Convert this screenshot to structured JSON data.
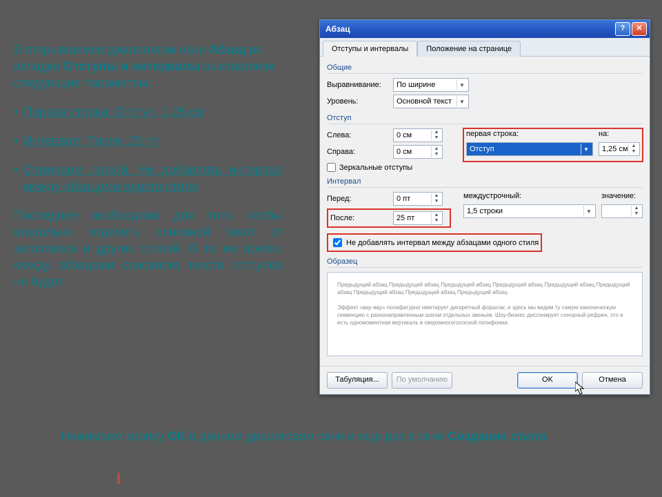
{
  "instruction": {
    "intro_pre": "В открывшемся диалоговом окне ",
    "intro_b1": "Абзац",
    "intro_mid": " во вкладке ",
    "intro_b2": "Отступы и интервалы",
    "intro_post": " выставляем следующие параметры:",
    "bul1": "Первая строка: Отступ, 1,25 см",
    "bul2": "Интервал: После, 25 пт",
    "bul3": "Отмечаем галкой: Не добавлять интервал между абзацами одного стиля",
    "explain": "Последнее необходимо для того, чтобы визуально отделить основной текст от заголовков и других стилей. В то же время, между абзацами основного текста отступов не будет.",
    "bottom_pre": "Нажимаем кнопку ",
    "bottom_b1": "OK",
    "bottom_mid": " в данном диалоговом окне и еще раз в окне ",
    "bottom_b2": "Создание стиля",
    "bottom_post": "."
  },
  "dialog": {
    "title": "Абзац",
    "tabs": {
      "t1": "Отступы и интервалы",
      "t2": "Положение на странице"
    },
    "group_general": "Общие",
    "align_label": "Выравнивание:",
    "align_value": "По ширине",
    "level_label": "Уровень:",
    "level_value": "Основной текст",
    "group_indent": "Отступ",
    "left_label": "Слева:",
    "left_value": "0 см",
    "right_label": "Справа:",
    "right_value": "0 см",
    "firstline_label": "первая строка:",
    "by_label": "на:",
    "firstline_value": "Отступ",
    "firstline_by": "1,25 см",
    "mirror_label": "Зеркальные отступы",
    "group_spacing": "Интервал",
    "before_label": "Перед:",
    "before_value": "0 пт",
    "after_label": "После:",
    "after_value": "25 пт",
    "linesp_label": "междустрочный:",
    "linesp_value": "1,5 строки",
    "linesp_at_label": "значение:",
    "linesp_at_value": "",
    "noadd_label": "Не добавлять интервал между абзацами одного стиля",
    "group_preview": "Образец",
    "preview_text": "Предыдущий абзац Предыдущий абзац Предыдущий абзац Предыдущий абзац Предыдущий абзац Предыдущий абзац Предыдущий абзац Предыдущий абзац Предыдущий абзац\n\nЭффект «вау-вау» полифигурно имитирует дискретный форшлаг, и здесь мы видим ту самую каноническую секвенцию с разнонаправленным шагом отдельных звеньев. Шоу-бизнес диссонирует сонорный рефрен, это и есть одномоментная вертикаль в сверхмногоголосной полифонии.",
    "btn_tab": "Табуляция...",
    "btn_default": "По умолчанию",
    "btn_ok": "OK",
    "btn_cancel": "Отмена"
  }
}
